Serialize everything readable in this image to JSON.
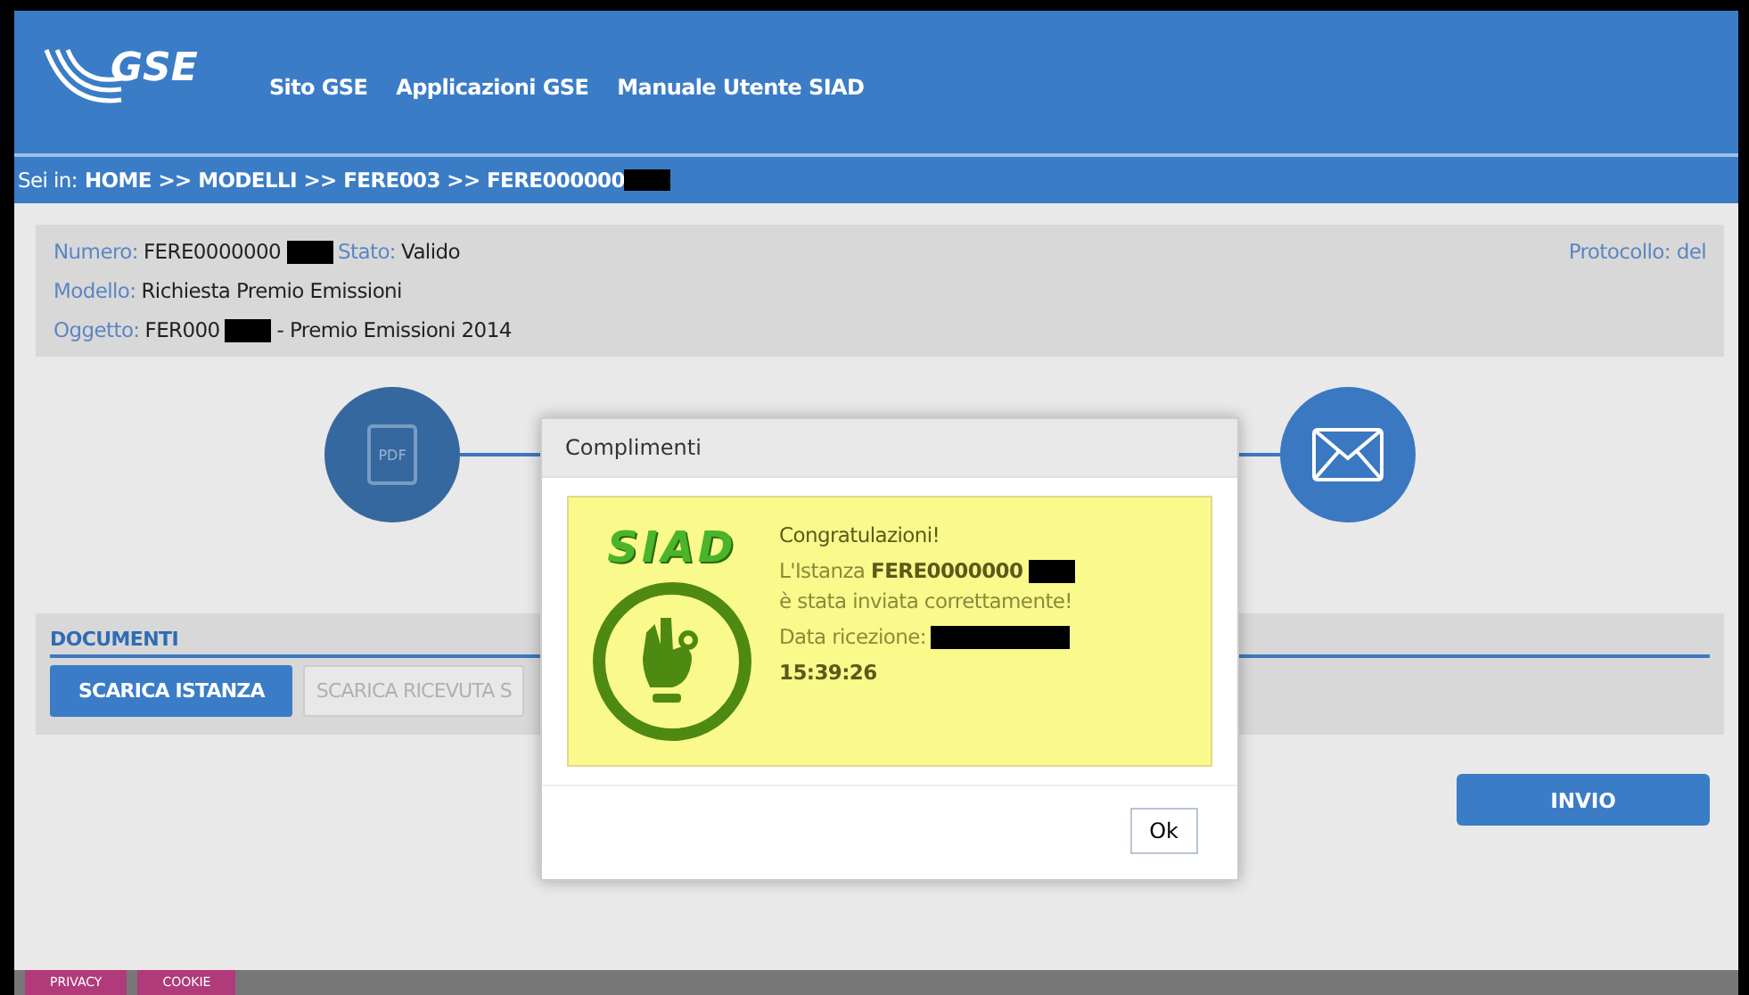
{
  "header": {
    "logo_text": "GSE",
    "nav": [
      "Sito GSE",
      "Applicazioni GSE",
      "Manuale Utente SIAD"
    ]
  },
  "breadcrumb": {
    "prefix": "Sei in:",
    "path": "HOME >> MODELLI >> FERE003 >> FERE000000",
    "redacted": true
  },
  "info": {
    "fields": [
      {
        "label": "Numero:",
        "value": "FERE0000000",
        "redacted": true
      },
      {
        "label": "Stato:",
        "value": "Valido",
        "redacted": false
      },
      {
        "label": "Modello:",
        "value": "Richiesta Premio Emissioni",
        "redacted": false
      },
      {
        "label": "Oggetto:",
        "value": "FER000",
        "redacted": true,
        "suffix": "- Premio Emissioni 2014"
      }
    ],
    "protocol": "Protocollo: del"
  },
  "steps": [
    {
      "kind": "pdf",
      "label": "PDF"
    },
    {
      "kind": "mail"
    }
  ],
  "documents": {
    "title": "DOCUMENTI",
    "buttons": [
      {
        "label": "SCARICA ISTANZA",
        "disabled": false
      },
      {
        "label": "SCARICA RICEVUTA S",
        "disabled": true
      }
    ]
  },
  "submit": "INVIO",
  "footer": {
    "tabs": [
      "PRIVACY",
      "COOKIE"
    ]
  },
  "modal": {
    "title": "Complimenti",
    "logo_text": "SIAD",
    "heading": "Congratulazioni!",
    "message_start": "L'Istanza **FERE0000000**",
    "message_end": "è stata inviata correttamente!",
    "date_label": "Data ricezione:",
    "time": "15:39:26",
    "button": "Ok"
  }
}
